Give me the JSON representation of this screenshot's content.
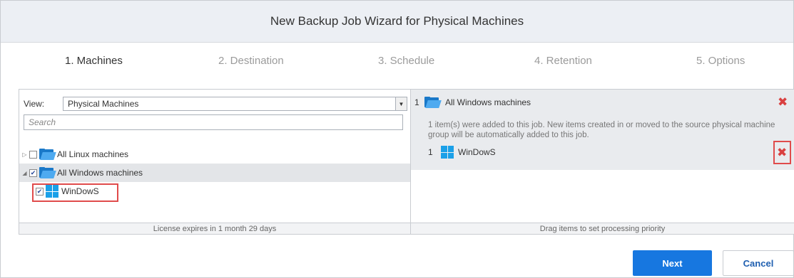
{
  "window": {
    "title": "New Backup Job Wizard for Physical Machines"
  },
  "steps": [
    {
      "label": "1. Machines",
      "active": true
    },
    {
      "label": "2. Destination",
      "active": false
    },
    {
      "label": "3. Schedule",
      "active": false
    },
    {
      "label": "4. Retention",
      "active": false
    },
    {
      "label": "5. Options",
      "active": false
    }
  ],
  "left_panel": {
    "view_label": "View:",
    "view_value": "Physical Machines",
    "search_placeholder": "Search",
    "tree": [
      {
        "label": "All Linux machines",
        "expander": "▷",
        "checked": false,
        "icon": "folder-icon"
      },
      {
        "label": "All Windows machines",
        "expander": "◢",
        "checked": true,
        "icon": "folder-icon",
        "selected": true
      },
      {
        "label": "WinDowS",
        "checked": true,
        "icon": "windows-icon"
      }
    ],
    "footer": "License expires in 1 month 29 days"
  },
  "right_panel": {
    "group_number": "1",
    "group_label": "All Windows machines",
    "description": "1 item(s) were added to this job. New items created in or moved to the source physical machine group will be automatically added to this job.",
    "item_number": "1",
    "item_label": "WinDowS",
    "footer": "Drag items to set processing priority"
  },
  "buttons": {
    "next": "Next",
    "cancel": "Cancel"
  },
  "colors": {
    "accent": "#1777e0",
    "remove": "#d94040",
    "highlight": "#e04b4b"
  }
}
